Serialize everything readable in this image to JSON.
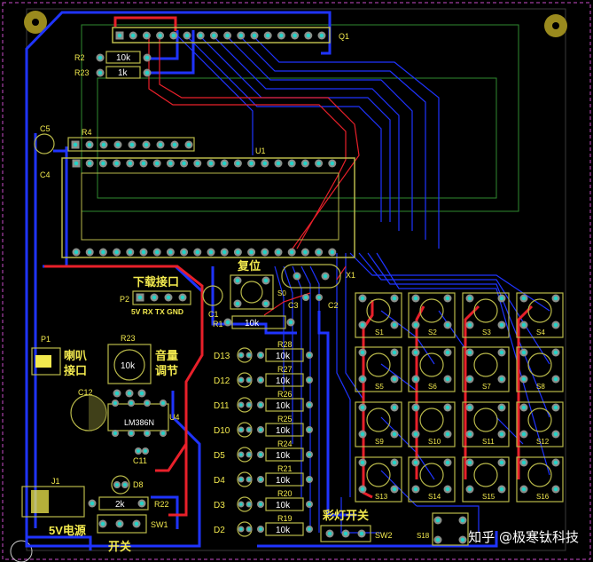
{
  "board": {
    "connectors": {
      "lcd": "Q1",
      "mcu": "U1",
      "crystal": "X1"
    },
    "resistors": [
      {
        "ref": "R2",
        "value": "10k"
      },
      {
        "ref": "R23",
        "value": "1k"
      },
      {
        "ref": "R1",
        "value": "10k"
      },
      {
        "ref": "R22",
        "value": "2k"
      }
    ],
    "header_r4": "R4",
    "caps": {
      "c5": "C5",
      "c4": "C4",
      "c1": "C1",
      "c3": "C3",
      "c2": "C2",
      "c12": "C12",
      "c11": "C11"
    },
    "reset_label": "复位",
    "reset_switch": "S0",
    "download": {
      "title": "下载接口",
      "ref": "P2",
      "pins": "5V RX TX GND"
    },
    "speaker": {
      "ref": "P1",
      "line1": "喇叭",
      "line2": "接口"
    },
    "volume": {
      "ref": "R23",
      "value": "10k",
      "line1": "音量",
      "line2": "调节"
    },
    "amp": {
      "ref": "U4",
      "chip": "LM386N"
    },
    "leds": [
      {
        "ref": "D13",
        "res": "R28",
        "val": "10k"
      },
      {
        "ref": "D12",
        "res": "R27",
        "val": "10k"
      },
      {
        "ref": "D11",
        "res": "R26",
        "val": "10k"
      },
      {
        "ref": "D10",
        "res": "R25",
        "val": "10k"
      },
      {
        "ref": "D5",
        "res": "R24",
        "val": "10k"
      },
      {
        "ref": "D4",
        "res": "R21",
        "val": "10k"
      },
      {
        "ref": "D3",
        "res": "R20",
        "val": "10k"
      },
      {
        "ref": "D2",
        "res": "R19",
        "val": "10k"
      }
    ],
    "power": {
      "jack": "J1",
      "label": "5V电源",
      "diode": "D8",
      "switch": "SW1",
      "switch_label": "开关"
    },
    "light_switch": {
      "label": "彩灯开关",
      "ref": "SW2"
    },
    "keys": [
      "S1",
      "S2",
      "S3",
      "S4",
      "S5",
      "S6",
      "S7",
      "S8",
      "S9",
      "S10",
      "S11",
      "S12",
      "S13",
      "S14",
      "S15",
      "S16"
    ],
    "s18": "S18",
    "colors": {
      "bg": "#000000",
      "blue": "#1f34ff",
      "red": "#e8202a",
      "silk": "#f2e94e",
      "outline": "#b9b94a",
      "pad": "#8a8f8a",
      "hole": "#23d3c8"
    }
  },
  "watermark": "知乎 @极寒钛科技"
}
